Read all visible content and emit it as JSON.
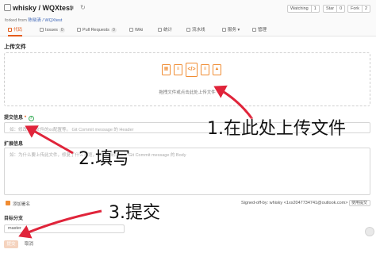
{
  "repo": {
    "owner": "whisky",
    "name": "WQXtest",
    "title": "whisky / WQXtest",
    "forked_prefix": "forked from ",
    "forked_source": "陈晓清 / WQXtest"
  },
  "header_buttons": {
    "watching": {
      "label": "Watching",
      "count": "1"
    },
    "star": {
      "label": "Star",
      "count": "0"
    },
    "fork": {
      "label": "Fork",
      "count": "2"
    }
  },
  "tabs": [
    {
      "label": "代码",
      "badge": "",
      "active": true
    },
    {
      "label": "Issues",
      "badge": "0",
      "active": false
    },
    {
      "label": "Pull Requests",
      "badge": "0",
      "active": false
    },
    {
      "label": "Wiki",
      "badge": "",
      "active": false
    },
    {
      "label": "统计",
      "badge": "",
      "active": false
    },
    {
      "label": "流水线",
      "badge": "",
      "active": false
    },
    {
      "label": "服务",
      "badge": "",
      "active": false
    },
    {
      "label": "管理",
      "badge": "",
      "active": false
    }
  ],
  "upload": {
    "section_title": "上传文件",
    "hint": "拖拽文件或点击此处上传文件",
    "file_icons": [
      "xls-file-icon",
      "txt-file-icon",
      "code-file-icon",
      "doc-file-icon",
      "pdf-file-icon"
    ]
  },
  "commit_message": {
    "label": "提交信息",
    "required_mark": "*",
    "placeholder": "如：修改了xx文件的xx配置等。 Git Commit message 的 Header"
  },
  "extended_info": {
    "label": "扩展信息",
    "placeholder": "如：为什么要上传此文件，修复了什么问题，有哪些新的改变 Git Commit message 的 Body"
  },
  "footer_options": {
    "checkbox_label": "添加署名",
    "signed_off": "Signed-off-by: whisky <1xx2047734741@outlook.com>",
    "signed_select": "使用提交"
  },
  "target_branch": {
    "label": "目标分支",
    "value": "master"
  },
  "actions": {
    "submit": "提交",
    "cancel": "取消"
  },
  "annotations": {
    "step1": "1.在此处上传文件",
    "step2": "2.填写",
    "step3": "3.提交"
  },
  "colors": {
    "accent": "#e35b1b",
    "file_icon": "#f08c32",
    "arrow": "#e0243a"
  }
}
